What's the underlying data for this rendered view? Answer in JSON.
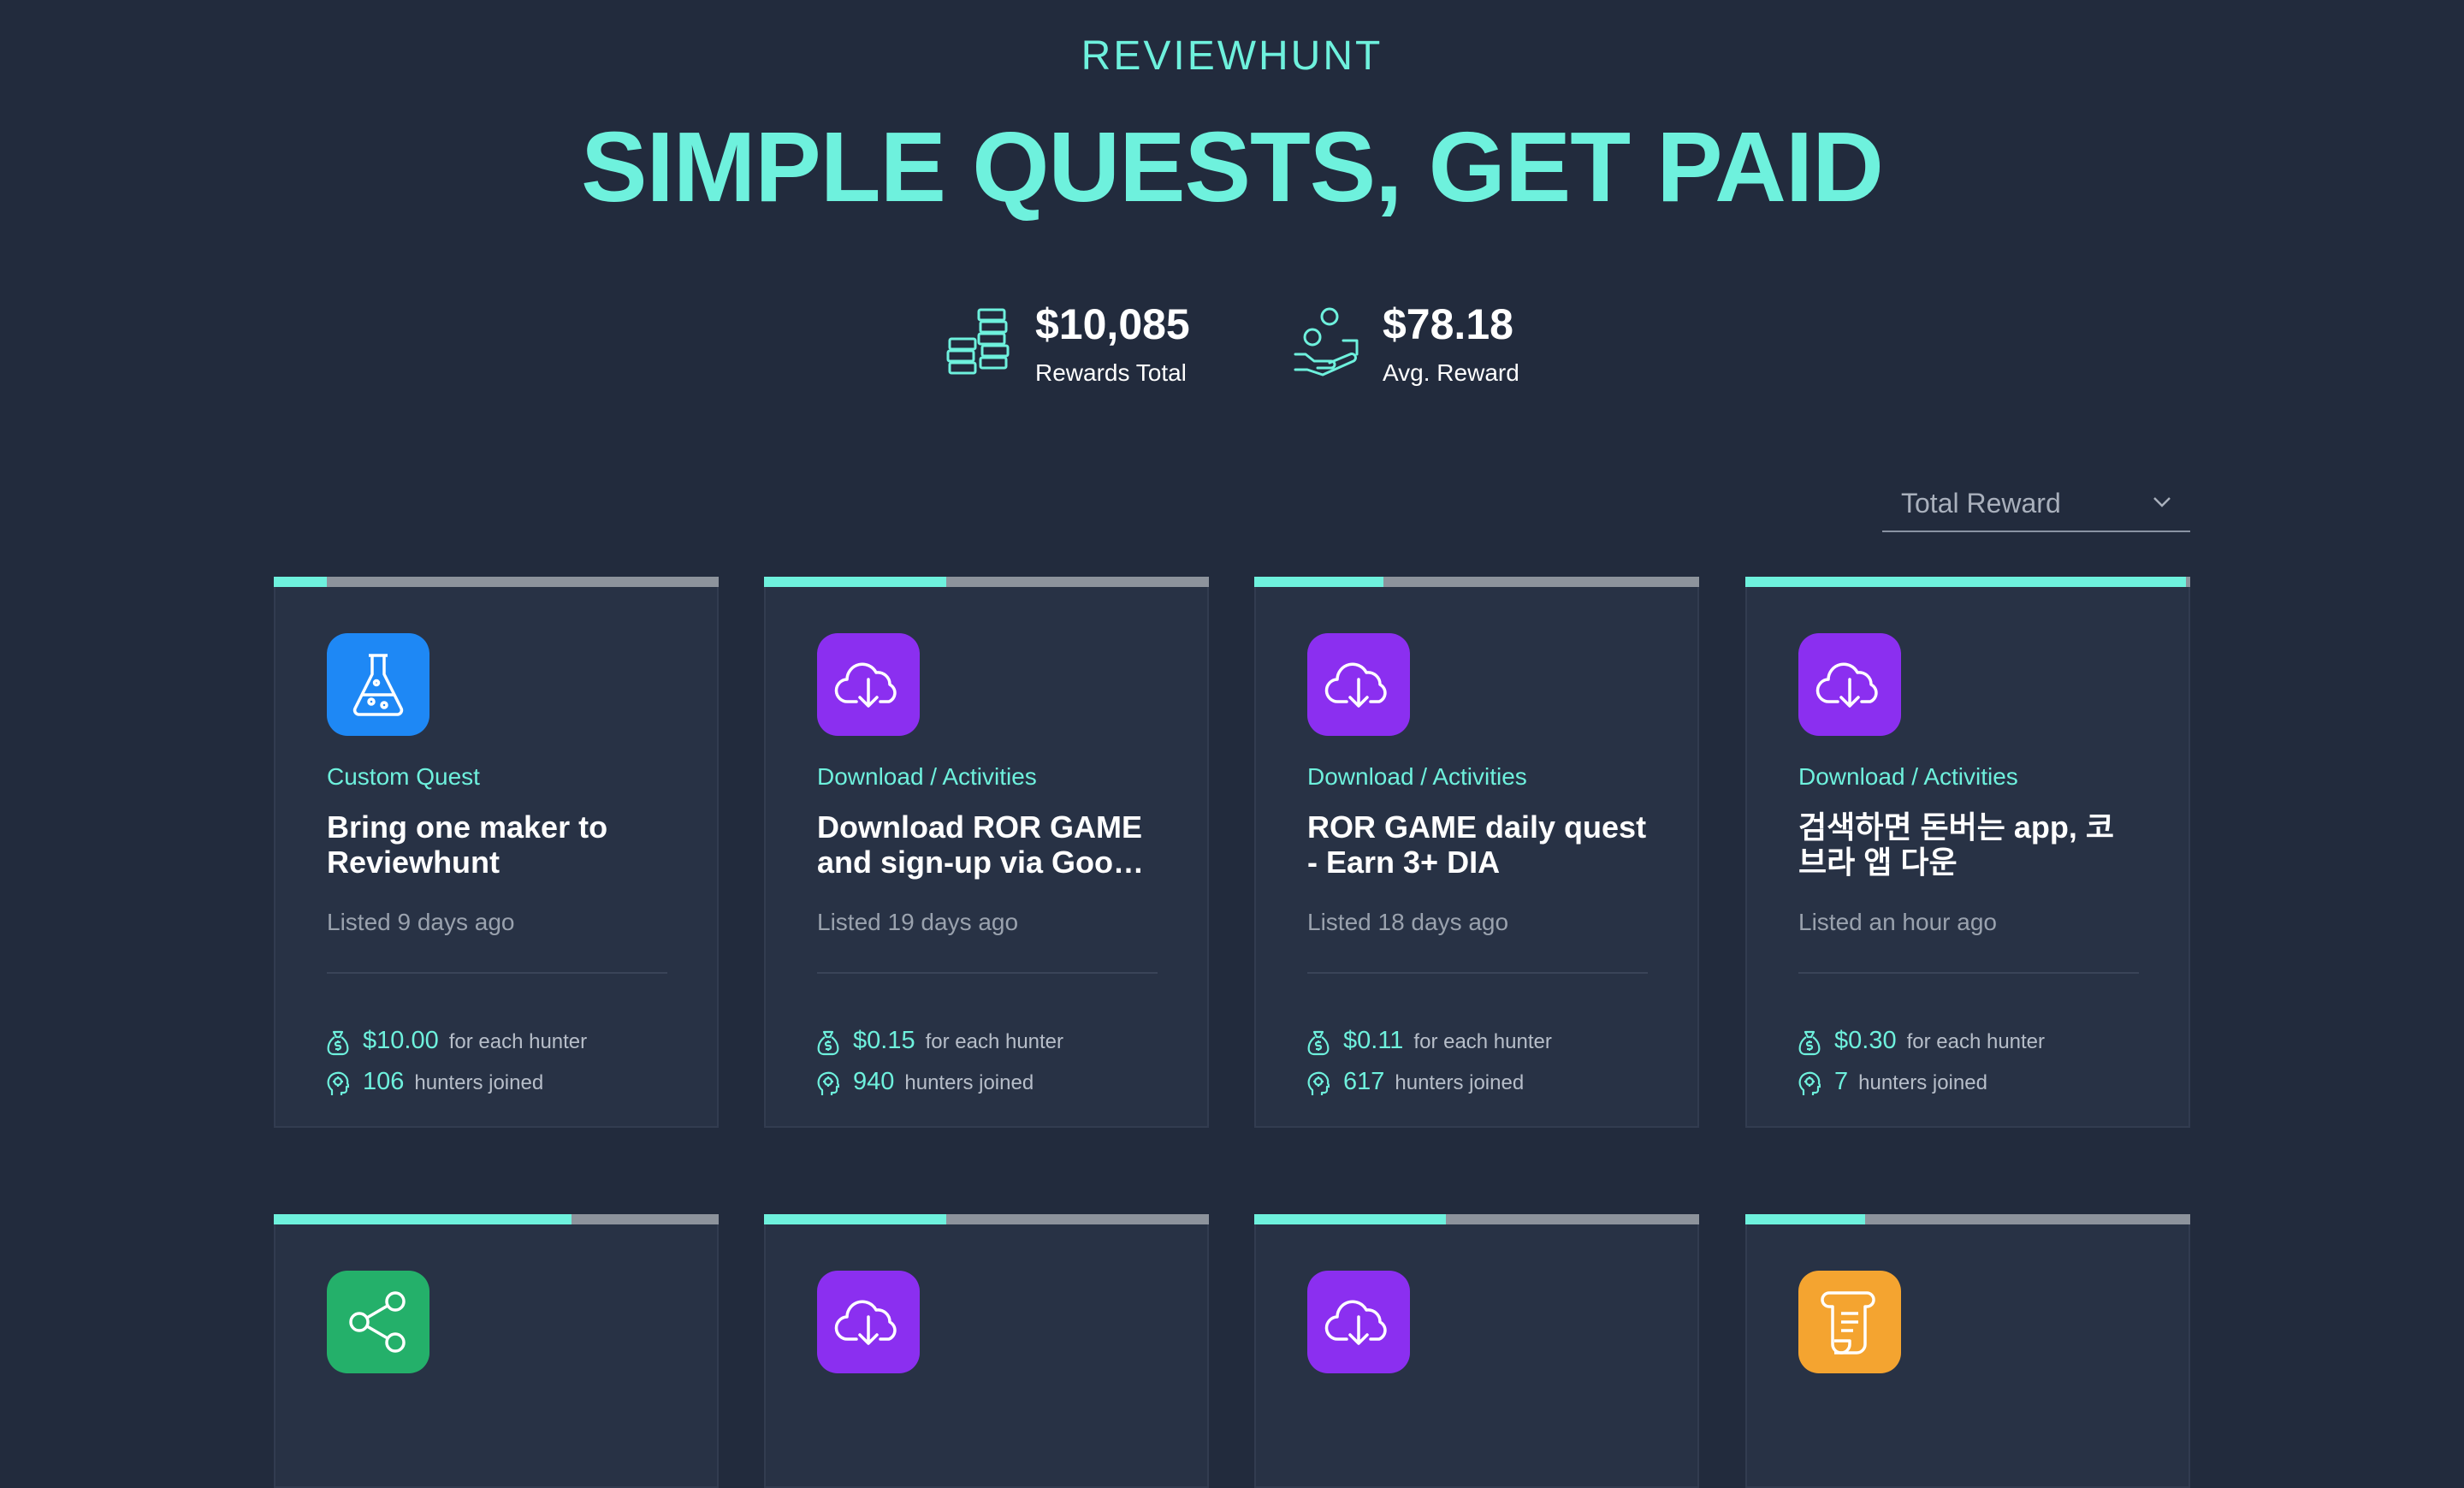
{
  "header": {
    "brand": "REVIEWHUNT",
    "headline": "SIMPLE QUESTS, GET PAID"
  },
  "stats": [
    {
      "value": "$10,085",
      "label": "Rewards Total",
      "icon": "coin-stacks-icon"
    },
    {
      "value": "$78.18",
      "label": "Avg. Reward",
      "icon": "hand-coins-icon"
    }
  ],
  "sort": {
    "selected": "Total Reward",
    "icon": "chevron-down-icon"
  },
  "colors": {
    "background": "#222b3d",
    "card": "#283245",
    "accent": "#6ef1dd",
    "icon_blue": "#1e88f5",
    "icon_purple": "#8b2ff0",
    "icon_green": "#24b06a",
    "icon_orange": "#f4a430"
  },
  "quests": [
    {
      "progress": 0.12,
      "icon": "flask-icon",
      "icon_color": "#1e88f5",
      "category": "Custom Quest",
      "title": "Bring one maker to Reviewhunt",
      "listed": "Listed 9 days ago",
      "reward": "$10.00",
      "reward_suffix": "for each hunter",
      "hunters": "106",
      "hunters_suffix": "hunters joined"
    },
    {
      "progress": 0.41,
      "icon": "cloud-download-icon",
      "icon_color": "#8b2ff0",
      "category": "Download / Activities",
      "title": "Download ROR GAME and sign-up via Google account",
      "listed": "Listed 19 days ago",
      "reward": "$0.15",
      "reward_suffix": "for each hunter",
      "hunters": "940",
      "hunters_suffix": "hunters joined"
    },
    {
      "progress": 0.29,
      "icon": "cloud-download-icon",
      "icon_color": "#8b2ff0",
      "category": "Download / Activities",
      "title": "ROR GAME daily quest - Earn 3+ DIA",
      "listed": "Listed 18 days ago",
      "reward": "$0.11",
      "reward_suffix": "for each hunter",
      "hunters": "617",
      "hunters_suffix": "hunters joined"
    },
    {
      "progress": 0.99,
      "icon": "cloud-download-icon",
      "icon_color": "#8b2ff0",
      "category": "Download / Activities",
      "title": "검색하면 돈버는 app, 코브라 앱 다운",
      "listed": "Listed an hour ago",
      "reward": "$0.30",
      "reward_suffix": "for each hunter",
      "hunters": "7",
      "hunters_suffix": "hunters joined"
    },
    {
      "progress": 0.67,
      "icon": "share-icon",
      "icon_color": "#24b06a"
    },
    {
      "progress": 0.41,
      "icon": "cloud-download-icon",
      "icon_color": "#8b2ff0"
    },
    {
      "progress": 0.43,
      "icon": "cloud-download-icon",
      "icon_color": "#8b2ff0"
    },
    {
      "progress": 0.27,
      "icon": "scroll-icon",
      "icon_color": "#f4a430"
    }
  ]
}
